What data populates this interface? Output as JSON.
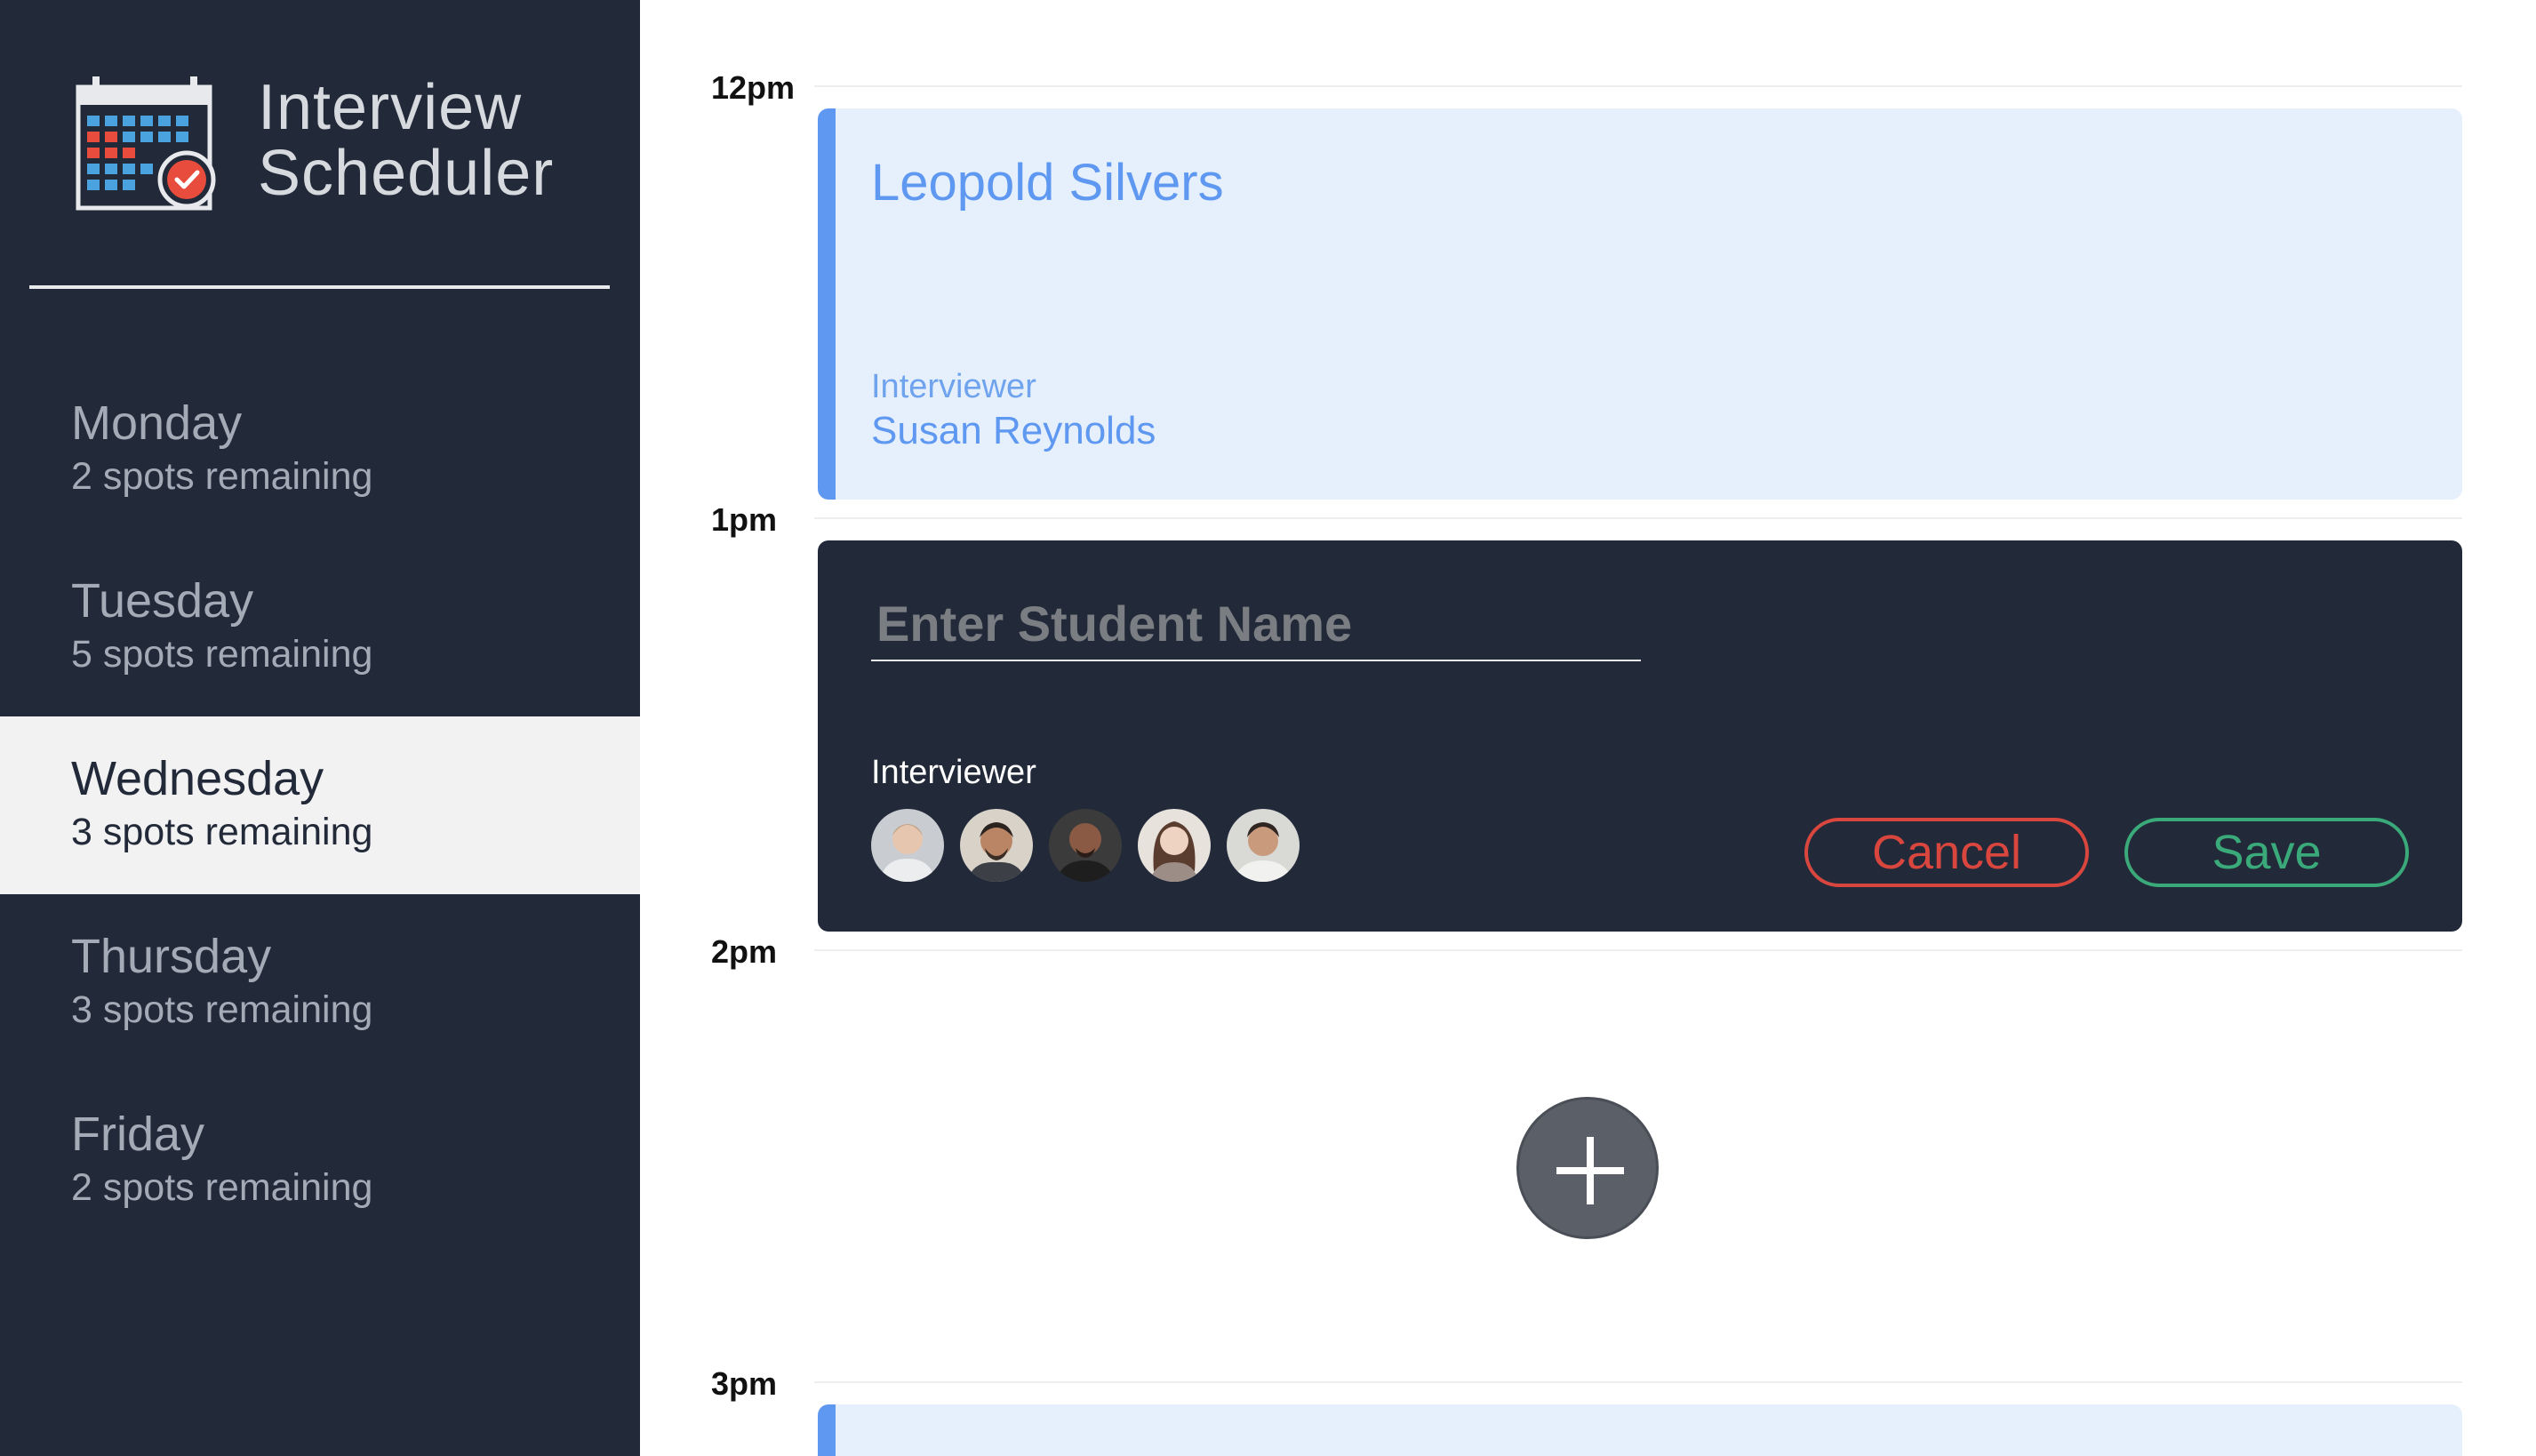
{
  "app": {
    "title_line1": "Interview",
    "title_line2": "Scheduler",
    "logo_icon": "calendar-check-icon"
  },
  "sidebar": {
    "days": [
      {
        "name": "Monday",
        "spots": "2 spots remaining",
        "selected": false
      },
      {
        "name": "Tuesday",
        "spots": "5 spots remaining",
        "selected": false
      },
      {
        "name": "Wednesday",
        "spots": "3 spots remaining",
        "selected": true
      },
      {
        "name": "Thursday",
        "spots": "3 spots remaining",
        "selected": false
      },
      {
        "name": "Friday",
        "spots": "2 spots remaining",
        "selected": false
      }
    ]
  },
  "schedule": {
    "times": [
      "12pm",
      "1pm",
      "2pm",
      "3pm"
    ],
    "booked": {
      "student": "Leopold Silvers",
      "interviewer_label": "Interviewer",
      "interviewer_name": "Susan Reynolds"
    },
    "form": {
      "student_value": "",
      "student_placeholder": "Enter Student Name",
      "interviewer_label": "Interviewer",
      "cancel_label": "Cancel",
      "save_label": "Save"
    },
    "add_icon": "plus-icon"
  },
  "colors": {
    "sidebar_bg": "#222a3a",
    "accent_blue": "#5f98f1",
    "booked_bg": "#e6f0fc",
    "cancel": "#d9463e",
    "save": "#3aaa7a"
  }
}
